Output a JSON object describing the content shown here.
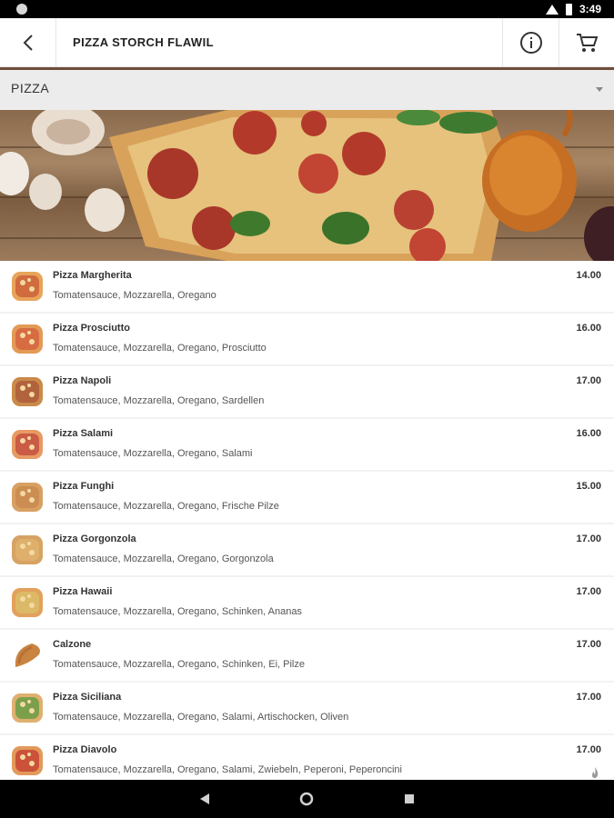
{
  "status_bar": {
    "time": "3:49"
  },
  "app_bar": {
    "title": "PIZZA STORCH FLAWIL",
    "icons": {
      "back": "arrow-back-icon",
      "info": "info-icon",
      "cart": "cart-icon"
    }
  },
  "category": {
    "label": "PIZZA"
  },
  "colors": {
    "accent": "#6e4e39",
    "background": "#f2f2f2"
  },
  "menu": {
    "items": [
      {
        "name": "Pizza Margherita",
        "desc": "Tomatensauce, Mozzarella, Oregano",
        "price": "14.00"
      },
      {
        "name": "Pizza Prosciutto",
        "desc": "Tomatensauce, Mozzarella, Oregano, Prosciutto",
        "price": "16.00"
      },
      {
        "name": "Pizza Napoli",
        "desc": "Tomatensauce, Mozzarella, Oregano, Sardellen",
        "price": "17.00"
      },
      {
        "name": "Pizza Salami",
        "desc": "Tomatensauce, Mozzarella, Oregano, Salami",
        "price": "16.00"
      },
      {
        "name": "Pizza Funghi",
        "desc": "Tomatensauce, Mozzarella, Oregano, Frische Pilze",
        "price": "15.00"
      },
      {
        "name": "Pizza Gorgonzola",
        "desc": "Tomatensauce, Mozzarella, Oregano, Gorgonzola",
        "price": "17.00"
      },
      {
        "name": "Pizza Hawaii",
        "desc": "Tomatensauce, Mozzarella, Oregano, Schinken, Ananas",
        "price": "17.00"
      },
      {
        "name": "Calzone",
        "desc": "Tomatensauce, Mozzarella, Oregano, Schinken, Ei, Pilze",
        "price": "17.00"
      },
      {
        "name": "Pizza Siciliana",
        "desc": "Tomatensauce, Mozzarella, Oregano, Salami, Artischocken, Oliven",
        "price": "17.00"
      },
      {
        "name": "Pizza Diavolo",
        "desc": "Tomatensauce, Mozzarella, Oregano, Salami, Zwiebeln, Peperoni, Peperoncini",
        "price": "17.00"
      }
    ]
  }
}
